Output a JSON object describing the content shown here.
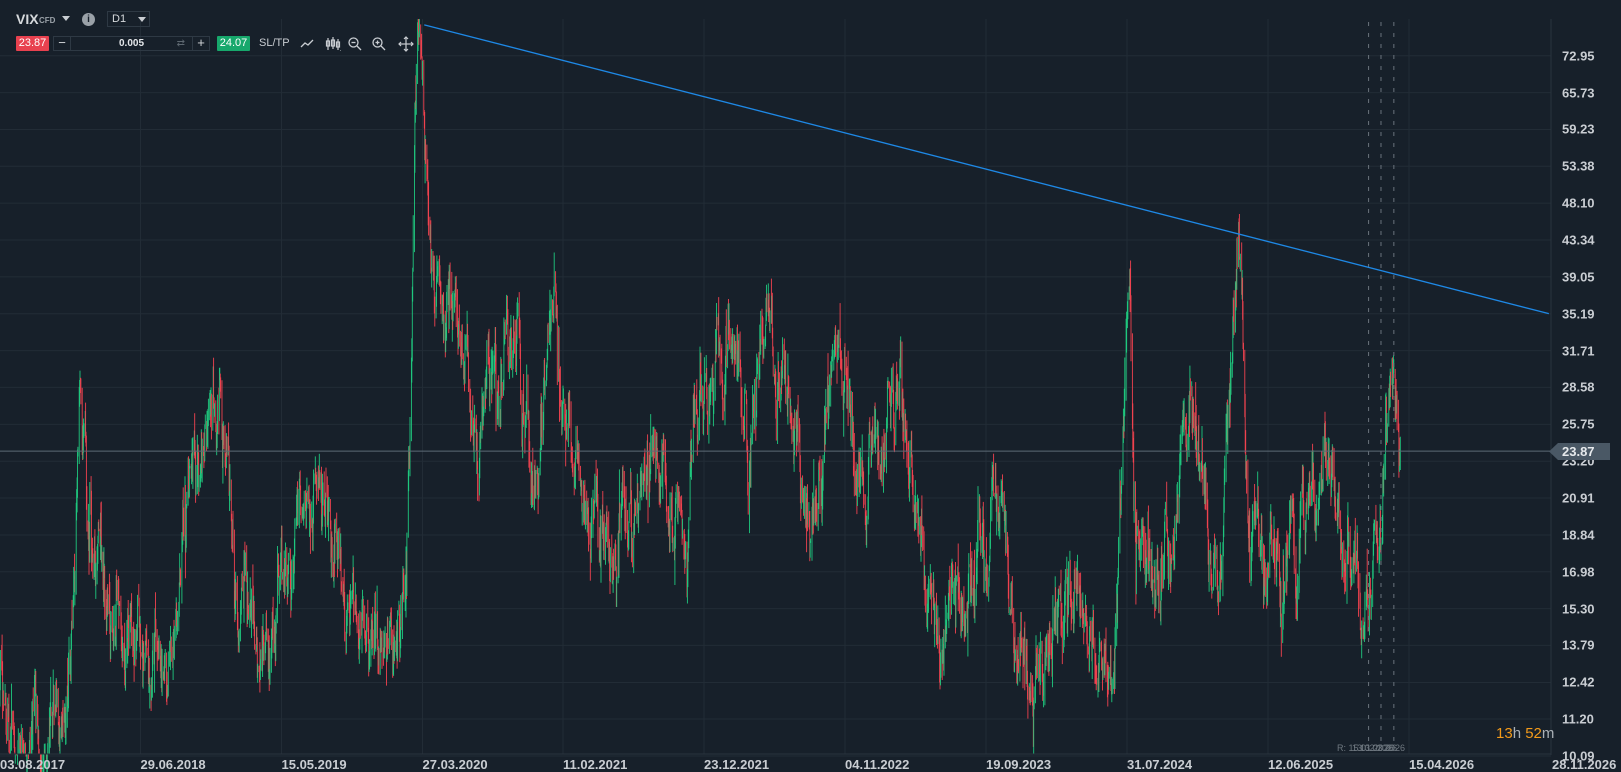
{
  "toolbar": {
    "symbol": "VIX",
    "symbol_type": "CFD",
    "timeframe": "D1",
    "sell_price": "23.87",
    "buy_price": "24.07",
    "quantity": "0.005",
    "sltp_label": "SL/TP",
    "icons": [
      "info-icon",
      "swap-icon",
      "line-chart-icon",
      "candlestick-icon",
      "zoom-out-icon",
      "zoom-in-icon",
      "move-icon"
    ]
  },
  "colors": {
    "background": "#17202a",
    "grid": "#222c36",
    "up": "#1fc77e",
    "down": "#f0424f",
    "trendline": "#1e88e5",
    "sell": "#e8414f",
    "buy": "#17a86c",
    "timer": "#f29a1a"
  },
  "countdown": {
    "hours": "13",
    "h": "h",
    "minutes": "52",
    "m": "m"
  },
  "markers_label": [
    "R: 15.01.2026",
    "13.02.2026",
    "13.03.2026"
  ],
  "chart_data": {
    "type": "candlestick",
    "y_scale": "log",
    "y_ticks": [
      "72.95",
      "65.73",
      "59.23",
      "53.38",
      "48.10",
      "43.34",
      "39.05",
      "35.19",
      "31.71",
      "28.58",
      "25.75",
      "23.20",
      "20.91",
      "18.84",
      "16.98",
      "15.30",
      "13.79",
      "12.42",
      "11.20",
      "10.09"
    ],
    "x_ticks": [
      "03.08.2017",
      "29.06.2018",
      "15.05.2019",
      "27.03.2020",
      "11.02.2021",
      "23.12.2021",
      "04.11.2022",
      "19.09.2023",
      "31.07.2024",
      "12.06.2025",
      "15.04.2026",
      "28.11.2026"
    ],
    "current_price": "23.87",
    "grid": true,
    "trendline": [
      [
        "2020-03-31",
        79.6
      ],
      [
        "2026-11-23",
        35.2
      ]
    ],
    "vertical_markers": [
      "2026-01-17",
      "2026-02-13",
      "2026-03-13"
    ],
    "price_path": [
      [
        "2017-05-25",
        15
      ],
      [
        "2017-07-01",
        11.5
      ],
      [
        "2017-10-01",
        10.5
      ],
      [
        "2018-01-20",
        11.5
      ],
      [
        "2018-02-06",
        29
      ],
      [
        "2018-03-01",
        18
      ],
      [
        "2018-06-01",
        14
      ],
      [
        "2018-09-01",
        13
      ],
      [
        "2018-10-25",
        22
      ],
      [
        "2018-12-24",
        26
      ],
      [
        "2019-02-01",
        16
      ],
      [
        "2019-04-15",
        13
      ],
      [
        "2019-05-15",
        19
      ],
      [
        "2019-08-05",
        22
      ],
      [
        "2019-10-01",
        16
      ],
      [
        "2019-12-20",
        13
      ],
      [
        "2020-02-20",
        16
      ],
      [
        "2020-03-16",
        76
      ],
      [
        "2020-04-20",
        40
      ],
      [
        "2020-06-12",
        35
      ],
      [
        "2020-08-01",
        24
      ],
      [
        "2020-09-05",
        30
      ],
      [
        "2020-10-30",
        36
      ],
      [
        "2020-12-01",
        22
      ],
      [
        "2021-01-27",
        35
      ],
      [
        "2021-03-01",
        24
      ],
      [
        "2021-06-15",
        17
      ],
      [
        "2021-09-20",
        24
      ],
      [
        "2021-11-15",
        16
      ],
      [
        "2021-12-01",
        28
      ],
      [
        "2022-03-07",
        33
      ],
      [
        "2022-04-01",
        20
      ],
      [
        "2022-05-10",
        34
      ],
      [
        "2022-08-15",
        20
      ],
      [
        "2022-10-13",
        33
      ],
      [
        "2022-12-01",
        21
      ],
      [
        "2023-03-13",
        27
      ],
      [
        "2023-06-01",
        14
      ],
      [
        "2023-08-15",
        16
      ],
      [
        "2023-10-20",
        21
      ],
      [
        "2023-12-15",
        12.5
      ],
      [
        "2024-04-15",
        16
      ],
      [
        "2024-07-01",
        12.5
      ],
      [
        "2024-08-05",
        38
      ],
      [
        "2024-08-20",
        16
      ],
      [
        "2024-11-01",
        18
      ],
      [
        "2024-12-18",
        26
      ],
      [
        "2025-02-20",
        16
      ],
      [
        "2025-04-08",
        45
      ],
      [
        "2025-05-01",
        20
      ],
      [
        "2025-07-15",
        17
      ],
      [
        "2025-10-16",
        24
      ],
      [
        "2025-11-20",
        17
      ],
      [
        "2026-01-15",
        15.5
      ],
      [
        "2026-02-10",
        19
      ],
      [
        "2026-03-09",
        30
      ],
      [
        "2026-03-28",
        23.87
      ]
    ]
  }
}
